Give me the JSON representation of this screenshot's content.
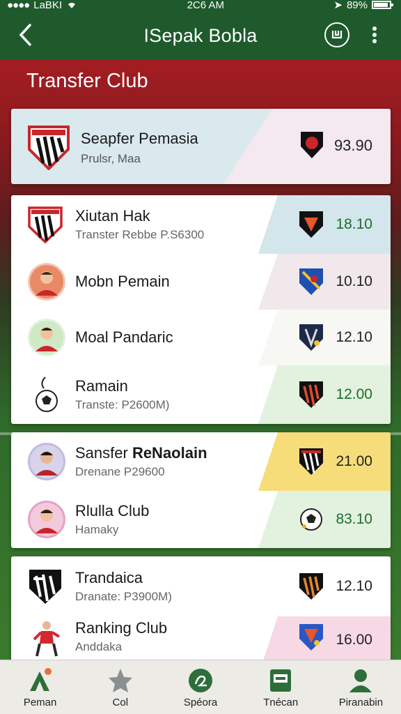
{
  "status": {
    "carrier": "LaBKI",
    "time": "2C6 AM",
    "battery": "89%"
  },
  "header": {
    "title": "ISepak Bobla"
  },
  "section": {
    "title": "Transfer Club"
  },
  "featured": {
    "name": "Seapfer Pemasia",
    "sub": "Prulsr, Maa",
    "value": "93.90"
  },
  "list1": [
    {
      "name": "Xiutan Hak",
      "sub": "Transter Rebbe P.S6300",
      "value": "18.10",
      "value_color": "#1f6b2d",
      "accent": "#d3e6ec"
    },
    {
      "name": "Mobn Pemain",
      "sub": "",
      "value": "10.10",
      "value_color": "#222",
      "accent": "#f1e8ec"
    },
    {
      "name": "Moal Pandaric",
      "sub": "",
      "value": "12.10",
      "value_color": "#222",
      "accent": "#f7f7f3"
    },
    {
      "name": "Ramain",
      "sub": "Transte: P2600M)",
      "value": "12.00",
      "value_color": "#1f6b2d",
      "accent": "#e2f2df"
    }
  ],
  "list2": [
    {
      "name": "Sansfer ",
      "name_bold": "ReNaolain",
      "sub": "Drenane P29600",
      "value": "21.00",
      "value_color": "#222",
      "accent": "#f6dd7a"
    },
    {
      "name": "Rlulla Club",
      "sub": "Hamaky",
      "value": "83.10",
      "value_color": "#1f6b2d",
      "accent": "#e2f2df"
    }
  ],
  "list3": [
    {
      "name": "Trandaica",
      "sub": "Dranate: P3900M)",
      "value": "12.10",
      "value_color": "#222",
      "accent": "#ffffff"
    },
    {
      "name": "Ranking Club",
      "sub": "Anddaka",
      "value": "16.00",
      "value_color": "#222",
      "accent": "#f7d9e6"
    }
  ],
  "nav": [
    {
      "label": "Peman"
    },
    {
      "label": "Col"
    },
    {
      "label": "Spéora"
    },
    {
      "label": "Tnécan"
    },
    {
      "label": "Piranabin"
    }
  ],
  "colors": {
    "header": "#1f5a2d",
    "accent_green": "#1f6b2d"
  }
}
